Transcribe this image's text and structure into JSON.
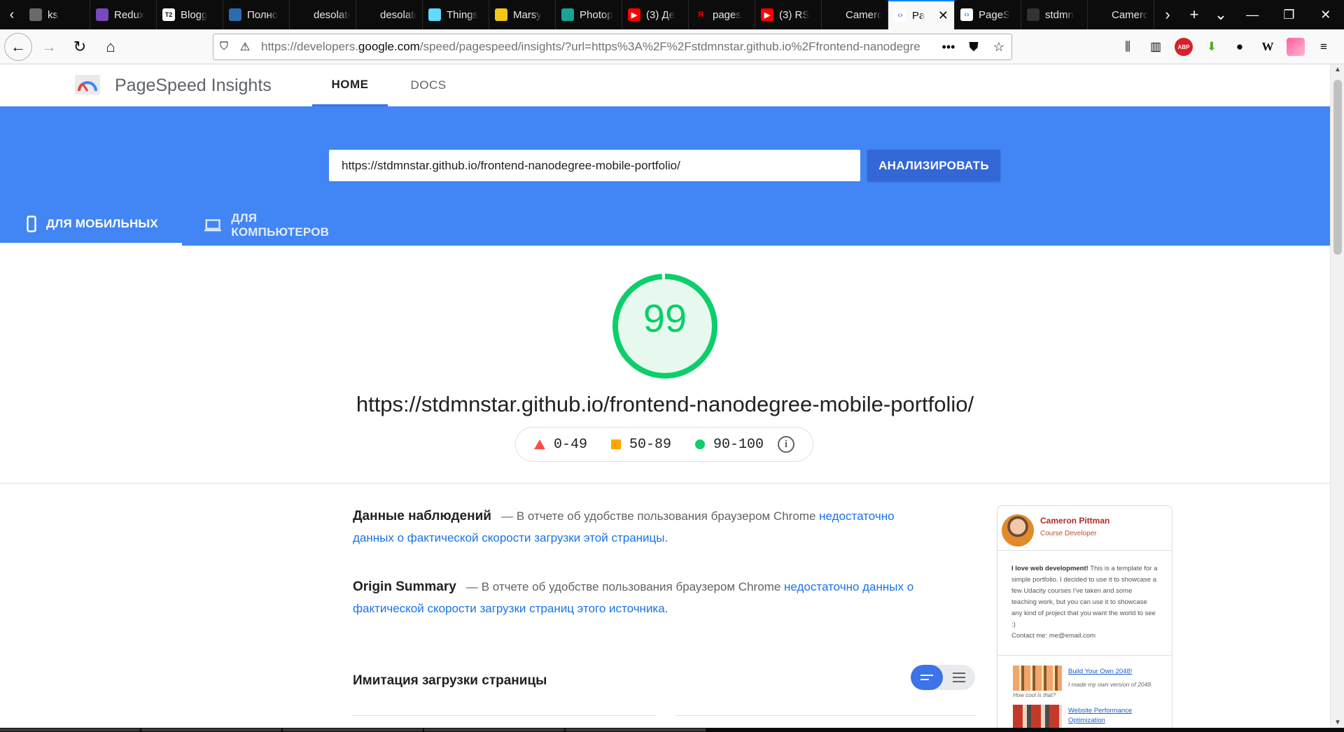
{
  "browser": {
    "tabs": [
      {
        "title": "ks",
        "icon": "generic-tab-icon",
        "color": "#6a6a6a"
      },
      {
        "title": "Redux",
        "icon": "redux-icon",
        "color": "#764abc"
      },
      {
        "title": "Blogg",
        "icon": "t2-icon",
        "color": "#ffffff"
      },
      {
        "title": "Полно",
        "icon": "snowflake-icon",
        "color": "#2b6cb0"
      },
      {
        "title": "desolate-f",
        "icon": "",
        "color": ""
      },
      {
        "title": "desolate-f",
        "icon": "",
        "color": ""
      },
      {
        "title": "Things",
        "icon": "react-icon",
        "color": "#61dafb"
      },
      {
        "title": "Marsy",
        "icon": "emoji-icon",
        "color": "#f5c518"
      },
      {
        "title": "Photop",
        "icon": "photopea-icon",
        "color": "#18a497"
      },
      {
        "title": "(3) Де",
        "icon": "youtube-icon",
        "color": "#ff0000"
      },
      {
        "title": "pages",
        "icon": "yandex-icon",
        "color": "#ff0000"
      },
      {
        "title": "(3) RS",
        "icon": "youtube-icon",
        "color": "#ff0000"
      },
      {
        "title": "Cameron P",
        "icon": "",
        "color": ""
      },
      {
        "title": "Pa",
        "icon": "pagespeed-icon",
        "color": "#4285f4",
        "active": true
      },
      {
        "title": "PageS",
        "icon": "pagespeed-icon",
        "color": "#4285f4"
      },
      {
        "title": "stdmn",
        "icon": "github-icon",
        "color": "#333333"
      },
      {
        "title": "Cameron P",
        "icon": "",
        "color": ""
      }
    ],
    "url_prefix": "https://developers.",
    "url_host": "google.com",
    "url_rest": "/speed/pagespeed/insights/?url=https%3A%2F%2Fstdmnstar.github.io%2Ffrontend-nanodegre"
  },
  "header": {
    "app_name": "PageSpeed Insights",
    "nav_home": "HOME",
    "nav_docs": "DOCS"
  },
  "search": {
    "value": "https://stdmnstar.github.io/frontend-nanodegree-mobile-portfolio/",
    "button_label": "АНАЛИЗИРОВАТЬ"
  },
  "device_tabs": {
    "mobile": "ДЛЯ МОБИЛЬНЫХ",
    "desktop": "ДЛЯ КОМПЬЮТЕРОВ"
  },
  "score": {
    "value": 99,
    "color": "#0cce6b",
    "tested_url": "https://stdmnstar.github.io/frontend-nanodegree-mobile-portfolio/"
  },
  "legend": {
    "fail": "0-49",
    "average": "50-89",
    "pass": "90-100"
  },
  "field_data": {
    "title": "Данные наблюдений",
    "text": "— В отчете об удобстве пользования браузером Chrome",
    "link": "недостаточно данных о фактической скорости загрузки этой страницы."
  },
  "origin_summary": {
    "title": "Origin Summary",
    "text": "— В отчете об удобстве пользования браузером Chrome",
    "link": "недостаточно данных о фактической скорости загрузки страниц этого источника."
  },
  "lab": {
    "title": "Имитация загрузки страницы"
  },
  "thumbnail": {
    "name": "Cameron Pittman",
    "role": "Course Developer",
    "intro_bold": "I love web development!",
    "intro": " This is a template for a simple portfolio. I decided to use it to showcase a few Udacity courses I've taken and some teaching work, but you can use it to showcase any kind of project that you want the world to see :)",
    "contact": "Contact me: me@email.com",
    "projects": [
      {
        "link": "Build Your Own 2048!",
        "desc": "I made my own version of 2048.",
        "caption": "How cool is that?"
      },
      {
        "link": "Website Performance Optimization",
        "desc": "",
        "caption": ""
      }
    ]
  }
}
